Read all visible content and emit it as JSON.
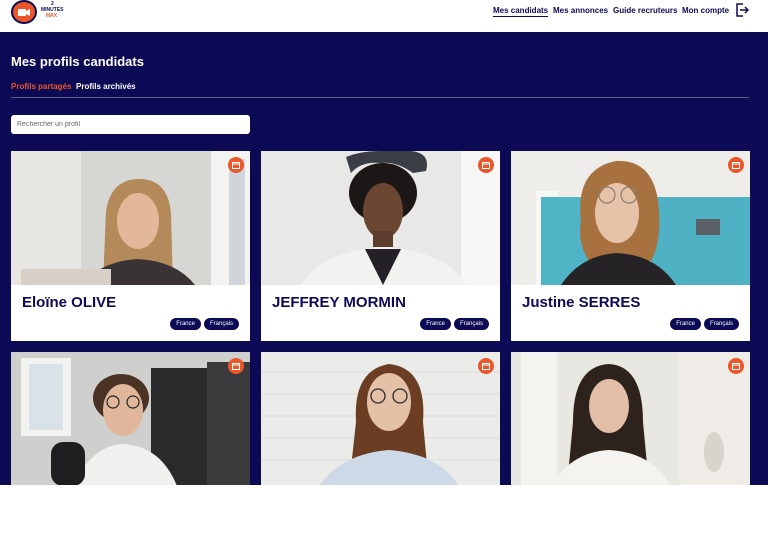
{
  "header": {
    "logo_line1": "2",
    "logo_line2": "MINUTES",
    "logo_line3": "MAX",
    "nav": [
      {
        "label": "Mes candidats"
      },
      {
        "label": "Mes annonces"
      },
      {
        "label": "Guide recruteurs"
      },
      {
        "label": "Mon compte"
      }
    ]
  },
  "page": {
    "title": "Mes profils candidats",
    "tabs": [
      {
        "label": "Profils partagés"
      },
      {
        "label": "Profils archivés"
      }
    ],
    "search": {
      "placeholder": "Rechercher un profil"
    }
  },
  "candidates": [
    {
      "name": "Eloïne OLIVE",
      "tags": [
        "France",
        "Français"
      ]
    },
    {
      "name": "JEFFREY MORMIN",
      "tags": [
        "France",
        "Français"
      ]
    },
    {
      "name": "Justine SERRES",
      "tags": [
        "France",
        "Français"
      ]
    },
    {
      "name": "",
      "tags": []
    },
    {
      "name": "",
      "tags": []
    },
    {
      "name": "",
      "tags": []
    }
  ],
  "colors": {
    "brand_dark": "#0d0a55",
    "accent": "#e9572a"
  },
  "icons": {
    "logo": "camera-icon",
    "logout": "logout-icon",
    "card_action": "archive-icon"
  }
}
